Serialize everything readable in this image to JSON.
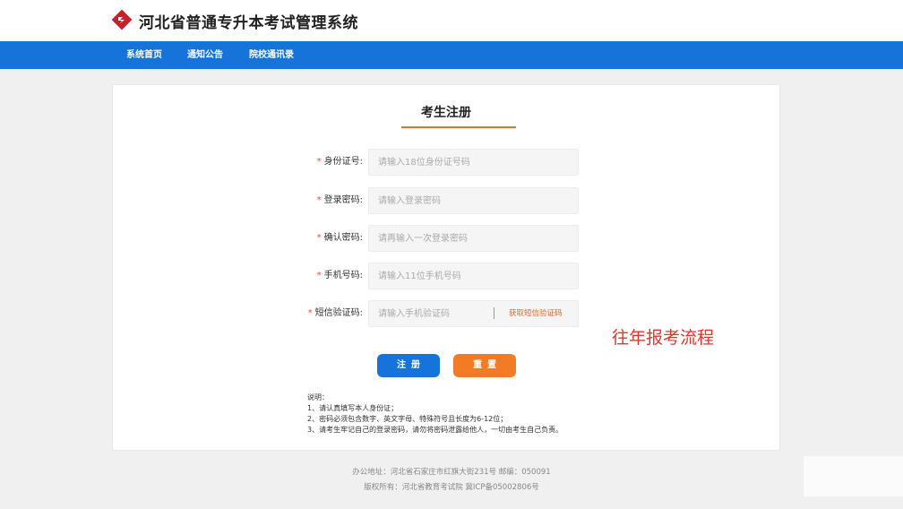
{
  "header": {
    "title": "河北省普通专升本考试管理系统",
    "logo_icon": "diamond-swirl-logo-icon",
    "accent": "#c8202a"
  },
  "nav": {
    "color": "#1673d9",
    "items": [
      {
        "label": "系统首页"
      },
      {
        "label": "通知公告"
      },
      {
        "label": "院校通讯录"
      }
    ]
  },
  "form": {
    "title": "考生注册",
    "required_mark": "*",
    "fields": [
      {
        "label": "身份证号:",
        "placeholder": "请输入18位身份证号码"
      },
      {
        "label": "登录密码:",
        "placeholder": "请输入登录密码"
      },
      {
        "label": "确认密码:",
        "placeholder": "请再输入一次登录密码"
      },
      {
        "label": "手机号码:",
        "placeholder": "请输入11位手机号码"
      },
      {
        "label": "短信验证码:",
        "placeholder": "请输入手机验证码"
      }
    ],
    "sms_button": "获取短信验证码",
    "register_button": "注册",
    "reset_button": "重置"
  },
  "notes": {
    "heading": "说明：",
    "items": [
      "1、请认真填写本人身份证；",
      "2、密码必须包含数字、英文字母、特殊符号且长度为6-12位；",
      "3、请考生牢记自己的登录密码，请勿将密码泄露给他人，一切由考生自己负责。"
    ]
  },
  "footer": {
    "address": "办公地址：河北省石家庄市红旗大街231号    邮编：050091",
    "copyright": "版权所有：河北省教育考试院 冀ICP备05002806号"
  },
  "overlay_caption": "往年报考流程",
  "colors": {
    "primary": "#1673d9",
    "orange": "#f47b25",
    "required": "#e84c3d",
    "caption": "#e8342a"
  }
}
